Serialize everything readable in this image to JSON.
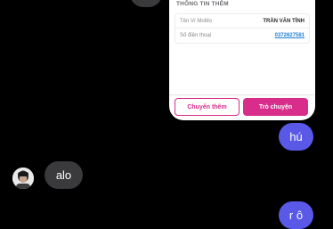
{
  "card": {
    "title": "THÔNG TIN THÊM",
    "rows": [
      {
        "label": "Tên Ví MoMo",
        "value": "TRẦN VĂN TÍNH"
      },
      {
        "label": "Số điện thoại",
        "value": "0372627581"
      }
    ],
    "buttons": {
      "secondary": "Chuyển thêm",
      "primary": "Trò chuyện"
    }
  },
  "messages": [
    {
      "direction": "outgoing",
      "text": "hú"
    },
    {
      "direction": "incoming",
      "text": "alo"
    },
    {
      "direction": "outgoing",
      "text": "r ô"
    }
  ],
  "colors": {
    "background": "#000000",
    "outgoing_bubble": "#5a58e6",
    "incoming_bubble": "#3a3a3c",
    "brand_pink": "#d82d8b",
    "link_blue": "#1e7fd6"
  }
}
